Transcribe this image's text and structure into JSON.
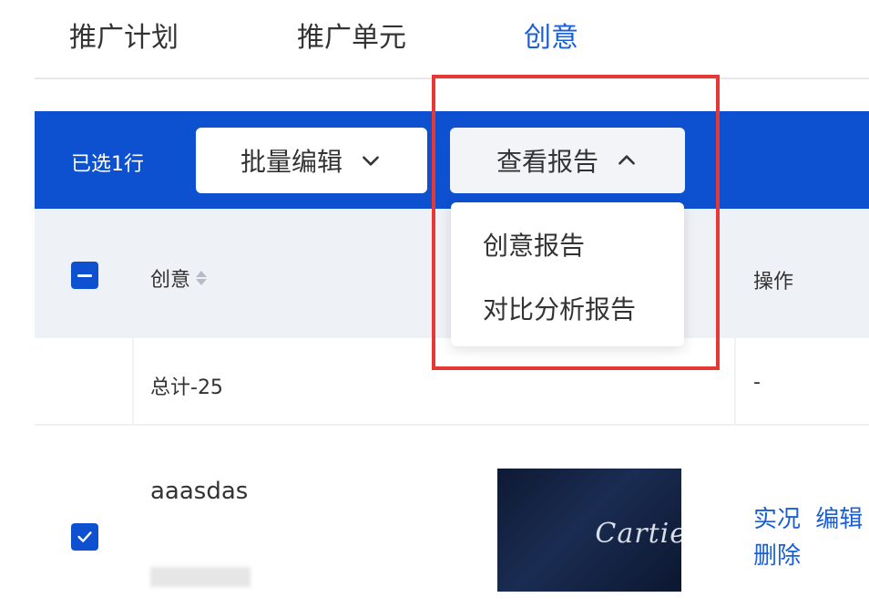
{
  "colors": {
    "accent": "#0d51d1",
    "accent_text": "#1b5fd6",
    "highlight": "#e53935"
  },
  "tabs": [
    {
      "label": "推广计划",
      "active": false
    },
    {
      "label": "推广单元",
      "active": false
    },
    {
      "label": "创意",
      "active": true
    }
  ],
  "action_bar": {
    "selected_text": "已选1行",
    "bulk_edit_label": "批量编辑",
    "view_report_label": "查看报告"
  },
  "report_menu": {
    "items": [
      "创意报告",
      "对比分析报告"
    ]
  },
  "table": {
    "columns": {
      "creative": "创意",
      "ops": "操作"
    },
    "total_row": {
      "label": "总计-25",
      "ops": "-"
    },
    "rows": [
      {
        "name": "aaasdas",
        "thumbnail_text": "Cartie",
        "actions": [
          "实况",
          "编辑",
          "删除"
        ]
      }
    ]
  }
}
